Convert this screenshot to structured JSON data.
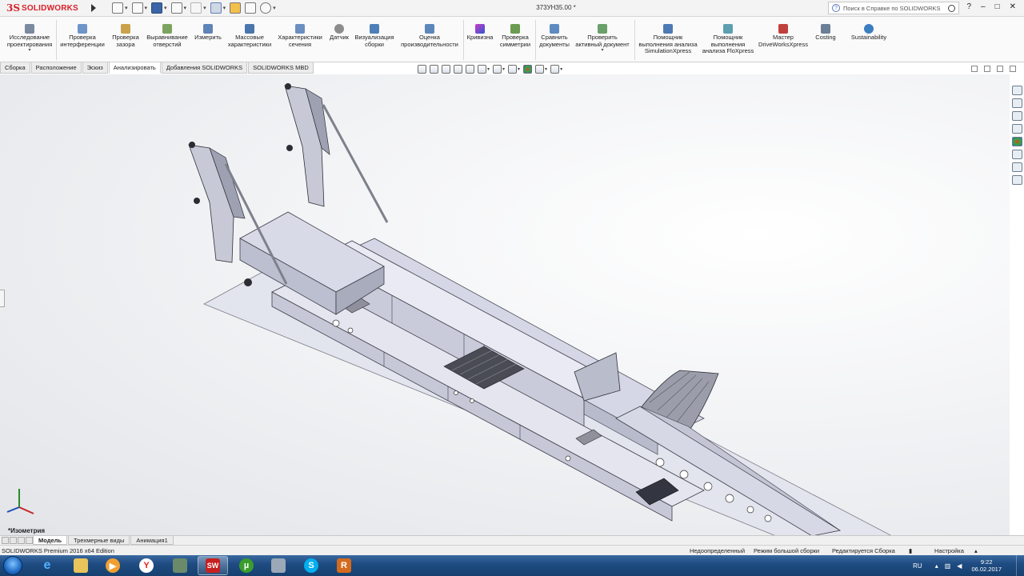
{
  "app": {
    "brand": "SOLIDWORKS",
    "document_title": "373УН35.00 *"
  },
  "help_search": {
    "placeholder": "Поиск в Справке по SOLIDWORKS"
  },
  "window_controls": [
    "?",
    "–",
    "□",
    "✕"
  ],
  "ribbon": {
    "buttons": [
      {
        "id": "design-study",
        "label": "Исследование\nпроектирования",
        "icon": "design-study-icon"
      },
      {
        "id": "interference",
        "label": "Проверка\nинтерференции",
        "icon": "interference-icon"
      },
      {
        "id": "clearance",
        "label": "Проверка\nзазора",
        "icon": "clearance-icon"
      },
      {
        "id": "hole-alignment",
        "label": "Выравнивание\nотверстий",
        "icon": "hole-alignment-icon"
      },
      {
        "id": "measure",
        "label": "Измерить",
        "icon": "measure-icon"
      },
      {
        "id": "mass-props",
        "label": "Массовые\nхарактеристики",
        "icon": "mass-properties-icon"
      },
      {
        "id": "section-props",
        "label": "Характеристики\nсечения",
        "icon": "section-properties-icon"
      },
      {
        "id": "sensor",
        "label": "Датчик",
        "icon": "sensor-icon"
      },
      {
        "id": "assembly-viz",
        "label": "Визуализация\nсборки",
        "icon": "assembly-visualization-icon"
      },
      {
        "id": "performance",
        "label": "Оценка\nпроизводительности",
        "icon": "performance-evaluation-icon"
      },
      {
        "id": "curvature",
        "label": "Кривизна",
        "icon": "curvature-icon"
      },
      {
        "id": "symmetry",
        "label": "Проверка\nсимметрии",
        "icon": "symmetry-check-icon"
      },
      {
        "id": "compare",
        "label": "Сравнить\nдокументы",
        "icon": "compare-documents-icon"
      },
      {
        "id": "check-active",
        "label": "Проверить\nактивный документ",
        "icon": "check-active-document-icon"
      },
      {
        "id": "simxpress",
        "label": "Помощник\nвыполнения анализа\nSimulationXpress",
        "icon": "simulationxpress-icon"
      },
      {
        "id": "floxpress",
        "label": "Помощник\nвыполнения\nанализа FloXpress",
        "icon": "floxpress-icon"
      },
      {
        "id": "driveworks",
        "label": "Мастер\nDriveWorksXpress",
        "icon": "driveworksxpress-icon"
      },
      {
        "id": "costing",
        "label": "Costing",
        "icon": "costing-icon"
      },
      {
        "id": "sustainability",
        "label": "Sustainability",
        "icon": "sustainability-icon"
      }
    ]
  },
  "command_tabs": [
    {
      "label": "Сборка",
      "active": false
    },
    {
      "label": "Расположение",
      "active": false
    },
    {
      "label": "Эскиз",
      "active": false
    },
    {
      "label": "Анализировать",
      "active": true
    },
    {
      "label": "Добавления SOLIDWORKS",
      "active": false
    },
    {
      "label": "SOLIDWORKS MBD",
      "active": false
    }
  ],
  "viewport": {
    "view_name": "*Изометрия"
  },
  "bottom_tabs": [
    {
      "label": "Модель",
      "active": true
    },
    {
      "label": "Трехмерные виды",
      "active": false
    },
    {
      "label": "Анимация1",
      "active": false
    }
  ],
  "status_bar": {
    "edition": "SOLIDWORKS Premium 2016 x64 Edition",
    "definition": "Недоопределенный",
    "mode": "Режим большой сборки",
    "editing": "Редактируется Сборка",
    "settings": "Настройка"
  },
  "taskbar": {
    "apps": [
      "ie-icon",
      "explorer-icon",
      "media-player-icon",
      "yandex-browser-icon",
      "sw-desktop-icon",
      "solidworks-icon",
      "utorrent-icon",
      "calculator-icon",
      "skype-icon",
      "revit-icon"
    ],
    "language": "RU",
    "time": "9:22",
    "date": "06.02.2017"
  }
}
